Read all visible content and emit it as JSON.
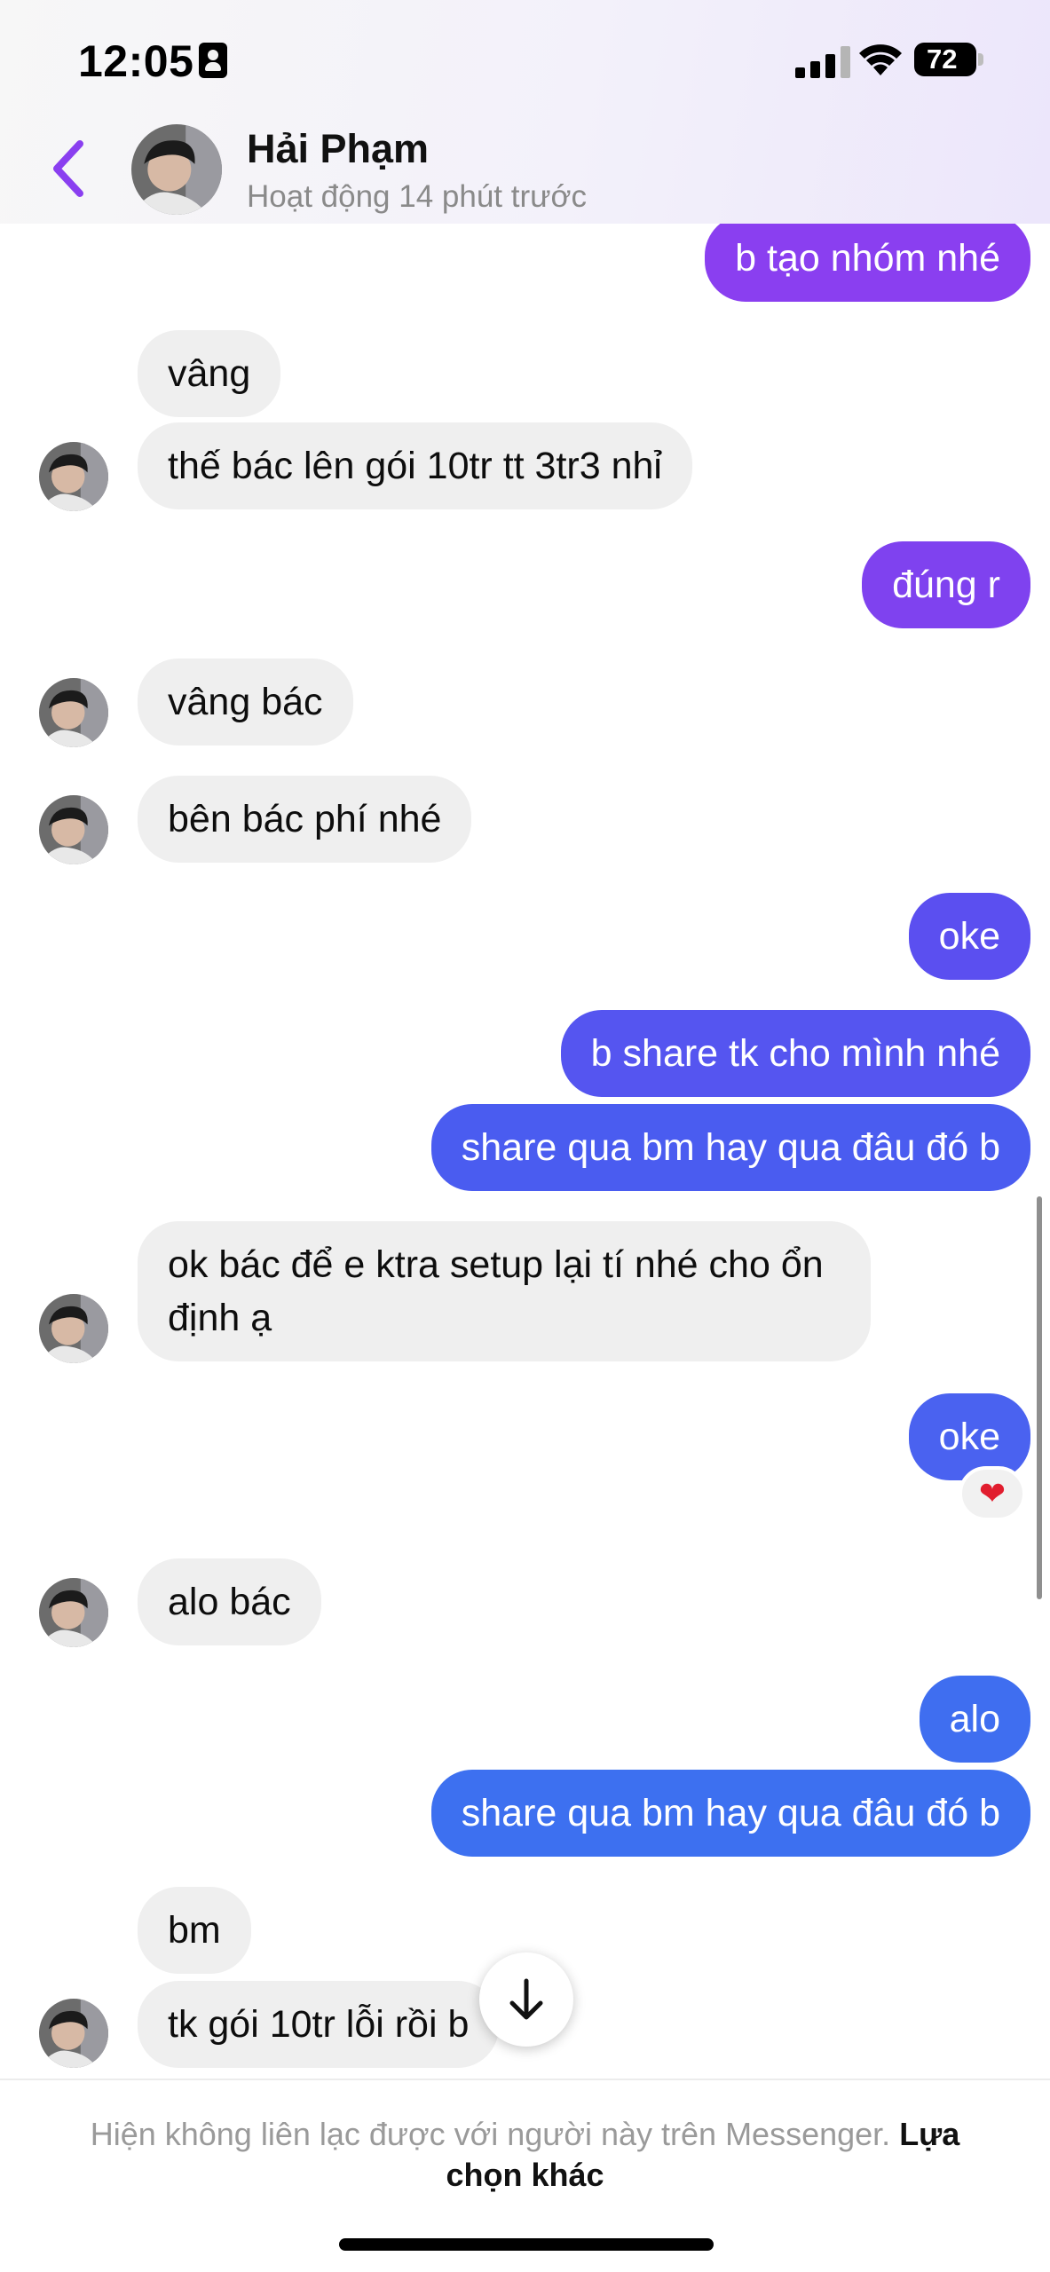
{
  "status_bar": {
    "time": "12:05",
    "battery": "72"
  },
  "header": {
    "contact_name": "Hải Phạm",
    "contact_status": "Hoạt động 14 phút trước"
  },
  "messages": [
    {
      "side": "out",
      "text": "b tạo nhóm nhé",
      "color": "#8a3ff0"
    },
    {
      "side": "in",
      "text": "vâng"
    },
    {
      "side": "in",
      "text": "thế bác lên gói 10tr tt 3tr3 nhỉ"
    },
    {
      "side": "out",
      "text": "đúng r",
      "color": "#7f42ef"
    },
    {
      "side": "in",
      "text": "vâng bác"
    },
    {
      "side": "in",
      "text": "bên bác phí nhé"
    },
    {
      "side": "out",
      "text": "oke",
      "color": "#5b4ff0"
    },
    {
      "side": "out",
      "text": "b share tk cho mình nhé",
      "color": "#5555f0"
    },
    {
      "side": "out",
      "text": "share qua bm hay qua đâu đó b",
      "color": "#4a5cf0"
    },
    {
      "side": "in",
      "text": "ok bác để e ktra setup lại tí nhé cho ổn định ạ"
    },
    {
      "side": "out",
      "text": "oke",
      "color": "#4a62f0",
      "reaction": "❤"
    },
    {
      "side": "in",
      "text": "alo bác"
    },
    {
      "side": "out",
      "text": "alo",
      "color": "#3f6ef0"
    },
    {
      "side": "out",
      "text": "share qua bm hay qua đâu đó b",
      "color": "#3d70f0"
    },
    {
      "side": "in",
      "text": "bm"
    },
    {
      "side": "in",
      "text": "tk gói 10tr lỗi rồi b"
    }
  ],
  "footer": {
    "notice": "Hiện không liên lạc được với người này trên Messenger.",
    "link": "Lựa chọn khác"
  },
  "icons": {
    "back": "chevron-left-icon",
    "scroll_down": "arrow-down-icon",
    "reaction": "heart-icon"
  }
}
